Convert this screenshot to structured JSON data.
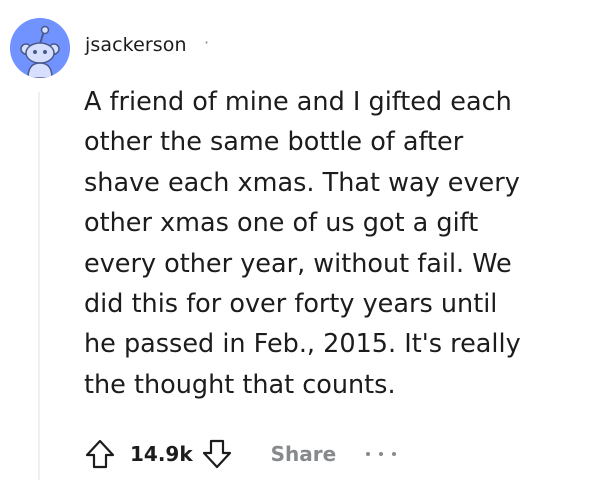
{
  "comment": {
    "author": "jsackerson",
    "separator": "·",
    "body_lines": [
      "A friend of mine and I gifted each",
      "other the same bottle of after",
      "shave each xmas. That way every",
      "other xmas one of us got a gift",
      "every other year, without fail. We",
      "did this for over forty years until",
      "he passed in Feb., 2015. It's really",
      "the thought that counts."
    ],
    "score": "14.9k",
    "share_label": "Share"
  },
  "icons": {
    "avatar": "snoo-avatar-icon",
    "upvote": "upvote-arrow-icon",
    "downvote": "downvote-arrow-icon",
    "more": "more-options-icon"
  },
  "colors": {
    "avatar_bg": "#7193ff",
    "text": "#1c1c1c",
    "muted": "#878a8c",
    "thread_line": "#edeff1"
  }
}
